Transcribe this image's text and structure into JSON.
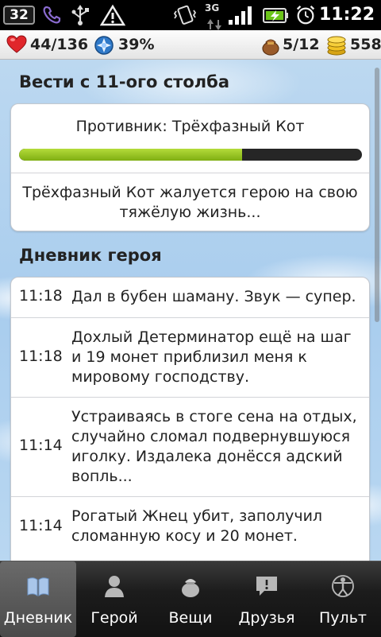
{
  "status_bar": {
    "notification_count": "32",
    "network_type": "3G",
    "clock": "11:22"
  },
  "stats": {
    "health": "44/136",
    "godpower": "39%",
    "inventory": "5/12",
    "gold": "558"
  },
  "news": {
    "title": "Вести с 11-ого столба",
    "opponent_label": "Противник: Трёхфазный Кот",
    "opponent_health_fraction": 0.65,
    "message": "Трёхфазный Кот жалуется герою на свою тяжёлую жизнь..."
  },
  "diary": {
    "title": "Дневник героя",
    "entries": [
      {
        "time": "11:18",
        "text": "Дал в бубен шаману. Звук — супер."
      },
      {
        "time": "11:18",
        "text": "Дохлый Детерминатор ещё на шаг и 19 монет приблизил меня к мировому господству."
      },
      {
        "time": "11:14",
        "text": "Устраиваясь в стоге сена на отдых, случайно сломал подвернувшуюся иголку. Издалека донёсся адский вопль..."
      },
      {
        "time": "11:14",
        "text": "Рогатый Жнец убит, заполучил сломанную косу и 20 монет."
      }
    ]
  },
  "tabs": [
    {
      "label": "Дневник",
      "icon": "book-icon",
      "active": true
    },
    {
      "label": "Герой",
      "icon": "person-icon",
      "active": false
    },
    {
      "label": "Вещи",
      "icon": "bag-icon",
      "active": false
    },
    {
      "label": "Друзья",
      "icon": "chat-icon",
      "active": false
    },
    {
      "label": "Пульт",
      "icon": "vitruvian-icon",
      "active": false
    }
  ],
  "colors": {
    "progress_fill": "#8fbf1f",
    "progress_track": "#262626",
    "sky": "#a9cdee"
  }
}
